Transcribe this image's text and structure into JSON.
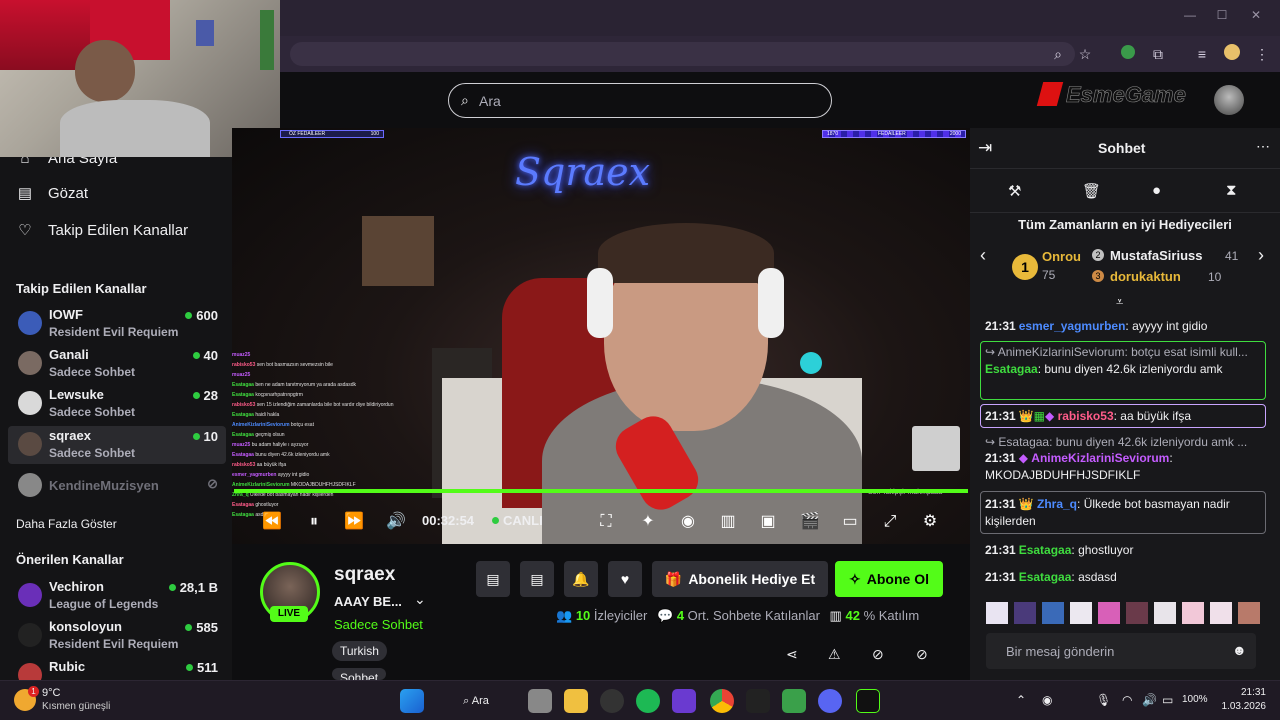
{
  "browser": {
    "window_controls": {
      "minimize": "—",
      "maximize": "☐",
      "close": "✕"
    }
  },
  "header": {
    "search_placeholder": "Ara",
    "logo_text": "EsmeGame"
  },
  "sidebar": {
    "nav": [
      {
        "label": "Ana Sayfa",
        "icon": "home-icon"
      },
      {
        "label": "Gözat",
        "icon": "browse-icon"
      },
      {
        "label": "Takip Edilen Kanallar",
        "icon": "heart-icon"
      }
    ],
    "followed_title": "Takip Edilen Kanallar",
    "followed": [
      {
        "name": "IOWF",
        "game": "Resident Evil Requiem",
        "viewers": "600",
        "avatar_color": "#3b5cb8"
      },
      {
        "name": "Ganali",
        "game": "Sadece Sohbet",
        "viewers": "40",
        "avatar_color": "#7a6a62"
      },
      {
        "name": "Lewsuke",
        "game": "Sadece Sohbet",
        "viewers": "28",
        "avatar_color": "#d9d9d9"
      },
      {
        "name": "sqraex",
        "game": "Sadece Sohbet",
        "viewers": "10",
        "avatar_color": "#5a4a42"
      },
      {
        "name": "KendineMuzisyen",
        "game": "",
        "viewers": "",
        "avatar_color": "#888888"
      }
    ],
    "show_more": "Daha Fazla Göster",
    "suggested_title": "Önerilen Kanallar",
    "suggested": [
      {
        "name": "Vechiron",
        "game": "League of Legends",
        "viewers": "28,1 B",
        "avatar_color": "#6a2fb8"
      },
      {
        "name": "konsoloyun",
        "game": "Resident Evil Requiem",
        "viewers": "585",
        "avatar_color": "#222222"
      },
      {
        "name": "Rubic",
        "game": "",
        "viewers": "511",
        "avatar_color": "#b83a3a"
      }
    ]
  },
  "stream": {
    "overlay_left_label": "ÖZ FEDAİLEER",
    "overlay_left_value": "100",
    "overlay_right_label": "FEDAİLEER",
    "overlay_right_value_a": "1870",
    "overlay_right_value_b": "2000",
    "neon_text": "Sqraex",
    "elapsed": "00:32:54",
    "live_label": "CANLI",
    "last_follower": "Son Takipçi: mahmpasa",
    "progress": 1.0,
    "overlay_chat": [
      {
        "user": "muaz25",
        "msg": ""
      },
      {
        "user": "rabisko53",
        "msg": "sen bot basmazsın sevmezsin bile"
      },
      {
        "user": "muaz25",
        "msg": ""
      },
      {
        "user": "Esatagaa",
        "msg": "ben ne adam tanıtmıyorum ya arada asdasdk"
      },
      {
        "user": "Esatagaa",
        "msg": "koçpınarhpatrınpgtrm"
      },
      {
        "user": "rabisko53",
        "msg": "sen 15 izlendiğim zamanlarda bile bot vardır diye bildiriyordun"
      },
      {
        "user": "Esatagaa",
        "msg": "haidi hakla"
      },
      {
        "user": "AnimeKizlariniSeviorum",
        "msg": "botçu esat"
      },
      {
        "user": "Esatagaa",
        "msg": "geçmiş olsun"
      },
      {
        "user": "muaz25",
        "msg": "bu adam haliyle ı ayzuyor"
      },
      {
        "user": "Esatagaa",
        "msg": "bunu diyen 42.6k izleniyordu amk"
      },
      {
        "user": "rabisko53",
        "msg": "aa büyük ifşa"
      },
      {
        "user": "esmer_yagmurben",
        "msg": "ayyyy int gidio"
      },
      {
        "user": "AnimeKizlariniSeviorum",
        "msg": "MKODAJBDUHFHJSDFIKLF"
      },
      {
        "user": "Zhra_q",
        "msg": "Ülkede bot basmayan nadir kişilerden"
      },
      {
        "user": "Esatagaa",
        "msg": "ghostluyor"
      },
      {
        "user": "Esatagaa",
        "msg": "asdasd"
      }
    ]
  },
  "channel": {
    "name": "sqraex",
    "title": "AAAY BE...",
    "category": "Sadece Sohbet",
    "live_badge": "LIVE",
    "tags": [
      "Turkish",
      "Sohbet"
    ],
    "gift_sub_label": "Abonelik Hediye Et",
    "subscribe_label": "Abone Ol",
    "viewers_value": "10",
    "viewers_label": "İzleyiciler",
    "chatters_value": "4",
    "chatters_label": "Ort. Sohbete Katılanlar",
    "participation_value": "42",
    "participation_label": "% Katılım"
  },
  "chat": {
    "title": "Sohbet",
    "leaderboard_title": "Tüm Zamanların en iyi Hediyecileri",
    "leaders": [
      {
        "rank": "1",
        "name": "Onrou",
        "count": "75",
        "color": "#e8b93a"
      },
      {
        "rank": "2",
        "name": "MustafaSiriuss",
        "count": "41",
        "color": "#c0c0c0"
      },
      {
        "rank": "3",
        "name": "dorukaktun",
        "count": "10",
        "color": "#cd8a45"
      }
    ],
    "messages": [
      {
        "time": "21:31",
        "user": "esmer_yagmurben",
        "color": "#4d8bff",
        "reply": "",
        "text": "ayyyy int gidio"
      },
      {
        "time": "",
        "user": "Esatagaa",
        "color": "#3fdc3f",
        "reply": "AnimeKizlariniSeviorum: botçu esat isimli kull...",
        "text": "bunu diyen 42.6k izleniyordu amk"
      },
      {
        "time": "21:31",
        "user": "rabisko53",
        "color": "#ff5c8a",
        "reply": "",
        "text": "aa büyük ifşa"
      },
      {
        "time": "21:31",
        "user": "AnimeKizlariniSeviorum",
        "color": "#c45cff",
        "reply": "Esatagaa: bunu diyen 42.6k izleniyordu amk ...",
        "text": "MKODAJBDUHFHJSDFIKLF"
      },
      {
        "time": "21:31",
        "user": "Zhra_q",
        "color": "#4d8bff",
        "reply": "",
        "text": "Ülkede bot basmayan nadir kişilerden"
      },
      {
        "time": "21:31",
        "user": "Esatagaa",
        "color": "#3fdc3f",
        "reply": "",
        "text": "ghostluyor"
      },
      {
        "time": "21:31",
        "user": "Esatagaa",
        "color": "#3fdc3f",
        "reply": "",
        "text": "asdasd"
      }
    ],
    "input_placeholder": "Bir mesaj gönderin"
  },
  "taskbar": {
    "weather_temp": "9°C",
    "weather_desc": "Kısmen güneşli",
    "weather_badge": "1",
    "search_label": "Ara",
    "battery": "100%",
    "time": "21:31",
    "date": "1.03.2026"
  },
  "colors": {
    "accent": "#53fc18",
    "live_green": "#2ecc40",
    "bg": "#0e0e10",
    "chat_bg": "#18181b"
  }
}
